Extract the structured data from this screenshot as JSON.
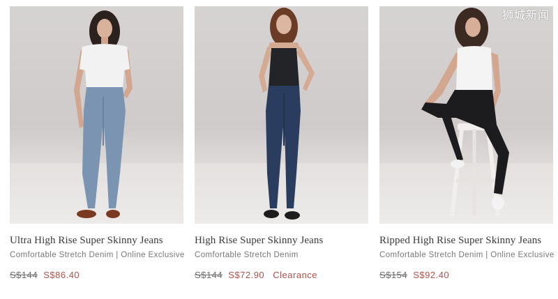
{
  "watermark": "狮城新闻",
  "products": [
    {
      "name": "Ultra High Rise Super Skinny Jeans",
      "subtitle": "Comfortable Stretch Denim | Online Exclusive",
      "original_price": "S$144",
      "sale_price": "S$86.40",
      "tag": ""
    },
    {
      "name": "High Rise Super Skinny Jeans",
      "subtitle": "Comfortable Stretch Denim",
      "original_price": "S$144",
      "sale_price": "S$72.90",
      "tag": "Clearance"
    },
    {
      "name": "Ripped High Rise Super Skinny Jeans",
      "subtitle": "Comfortable Stretch Denim | Online Exclusive",
      "original_price": "S$154",
      "sale_price": "S$92.40",
      "tag": ""
    }
  ],
  "colors": {
    "sale_price": "#b0524b",
    "original_price": "#6c6c6c",
    "title": "#3a3a3a",
    "subtitle": "#777777"
  }
}
